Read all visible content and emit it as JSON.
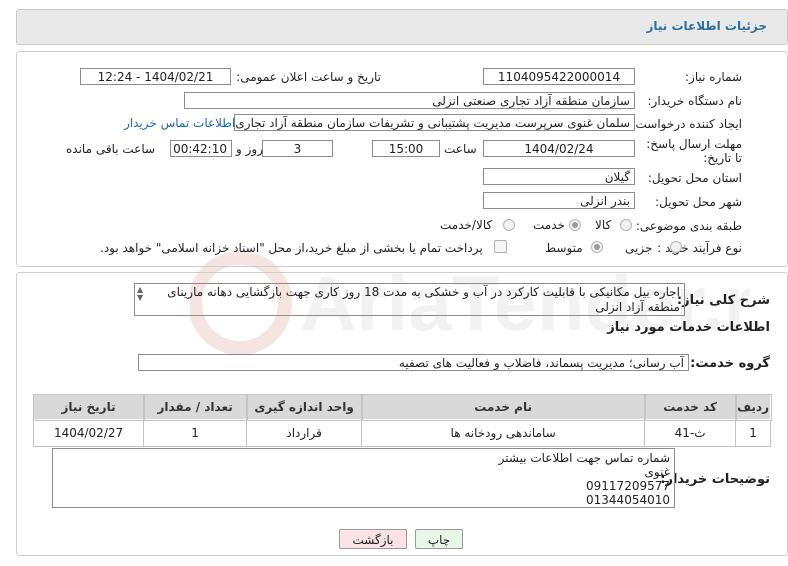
{
  "header": {
    "title": "جزئیات اطلاعات نیاز"
  },
  "watermark": {
    "text": "AriaTender.neT"
  },
  "fields": {
    "need_number": {
      "label": "شماره نیاز:",
      "value": "1104095422000014"
    },
    "announce_datetime": {
      "label": "تاریخ و ساعت اعلان عمومی:",
      "value": "1404/02/21 - 12:24"
    },
    "buyer_org": {
      "label": "نام دستگاه خریدار:",
      "value": "سازمان منطقه آزاد تجاری  صنعتی انزلی"
    },
    "requester": {
      "label": "ایجاد کننده درخواست:",
      "value": "سلمان غنوی سرپرست مدیریت پشتیبانی و تشریفات سازمان منطقه آزاد تجاری",
      "contact_link": "اطلاعات تماس خریدار"
    },
    "deadline": {
      "label": "مهلت ارسال پاسخ: تا تاریخ:",
      "date": "1404/02/24",
      "time_label": "ساعت",
      "time": "15:00",
      "days": "3",
      "days_label": "روز و",
      "remaining": "00:42:10",
      "remaining_label": "ساعت باقی مانده"
    },
    "province": {
      "label": "استان محل تحویل:",
      "value": "گیلان"
    },
    "city": {
      "label": "شهر محل تحویل:",
      "value": "بندر انزلی"
    },
    "category": {
      "label": "طبقه بندی موضوعی:",
      "options": [
        "کالا",
        "خدمت",
        "کالا/خدمت"
      ],
      "selected": "خدمت"
    },
    "purchase_type": {
      "label": "نوع فرآیند خرید :",
      "options": [
        "جزیی",
        "متوسط"
      ],
      "selected": "متوسط",
      "note": "پرداخت تمام یا بخشی از مبلغ خرید،از محل \"اسناد خزانه اسلامی\" خواهد بود."
    }
  },
  "description": {
    "label": "شرح کلی نیاز:",
    "value": "اجاره بیل مکانیکی با قابلیت کارکرد در آب و خشکی به مدت 18 روز کاری جهت بازگشایی دهانه مارینای منطقه آزاد انزلی"
  },
  "services_section": {
    "title": "اطلاعات خدمات مورد نیاز",
    "group_label": "گروه خدمت:",
    "group_value": "آب رسانی؛ مدیریت پسماند، فاضلاب و فعالیت های تصفیه",
    "table": {
      "headers": [
        "ردیف",
        "کد خدمت",
        "نام خدمت",
        "واحد اندازه گیری",
        "تعداد / مقدار",
        "تاریخ نیاز"
      ],
      "rows": [
        [
          "1",
          "ث-41",
          "ساماندهی رودخانه ها",
          "قرارداد",
          "1",
          "1404/02/27"
        ]
      ]
    }
  },
  "buyer_notes": {
    "label": "توضیحات خریدار:",
    "lines": [
      "شماره تماس جهت اطلاعات بیشتر",
      "غنوی",
      "09117209577",
      "01344054010"
    ]
  },
  "buttons": {
    "print": "چاپ",
    "back": "بازگشت"
  },
  "colors": {
    "title_text": "#2c6fa0",
    "link": "#1b6ab0",
    "print_bg": "#e8f7e8",
    "back_bg": "#f9e3e6"
  }
}
